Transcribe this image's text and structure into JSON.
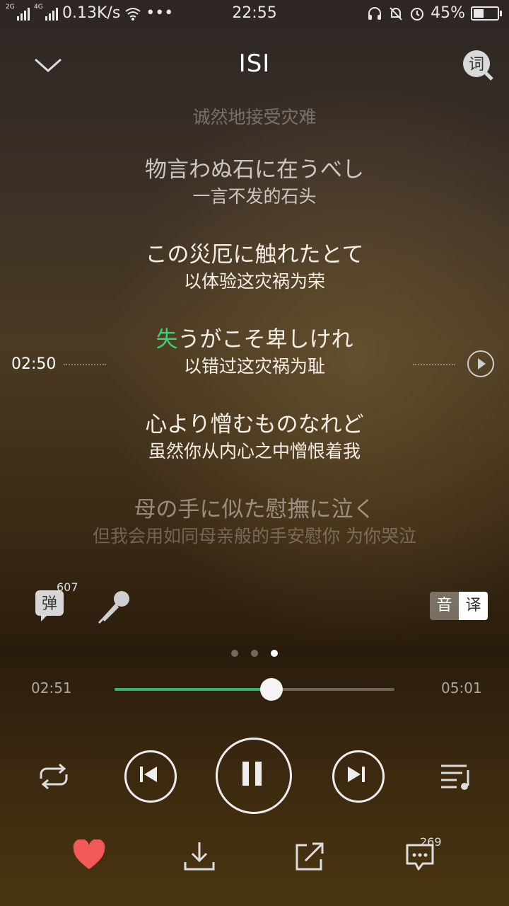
{
  "status_bar": {
    "net1": "2G",
    "net2": "4G",
    "speed": "0.13K/s",
    "more": "•••",
    "time": "22:55",
    "battery": "45%",
    "battery_level": 0.45
  },
  "header": {
    "title": "ISI",
    "lyrics_button": "词"
  },
  "lyrics": [
    {
      "jp": "",
      "cn": "诚然地接受灾难"
    },
    {
      "jp": "物言わぬ石に在うべし",
      "cn": "一言不发的石头"
    },
    {
      "jp": "この災厄に触れたとて",
      "cn": "以体验这灾祸为荣"
    },
    {
      "jp_highlight": "失",
      "jp_rest": "うがこそ卑しけれ",
      "cn": "以错过这灾祸为耻"
    },
    {
      "jp": "心より憎むものなれど",
      "cn": "虽然你从内心之中憎恨着我"
    },
    {
      "jp": "母の手に似た慰撫に泣く",
      "cn": "但我会用如同母亲般的手安慰你 为你哭泣"
    }
  ],
  "seek_indicator": {
    "time": "02:50"
  },
  "tools": {
    "danmu_label": "弹",
    "danmu_count": "607",
    "toggle_left": "音",
    "toggle_right": "译"
  },
  "pager": {
    "count": 3,
    "active": 2
  },
  "progress": {
    "elapsed": "02:51",
    "duration": "05:01",
    "fraction": 0.56
  },
  "actions": {
    "comment_count": "269"
  },
  "colors": {
    "accent": "#3fd07a",
    "progress": "#36b26b",
    "like": "#f25a5a"
  }
}
